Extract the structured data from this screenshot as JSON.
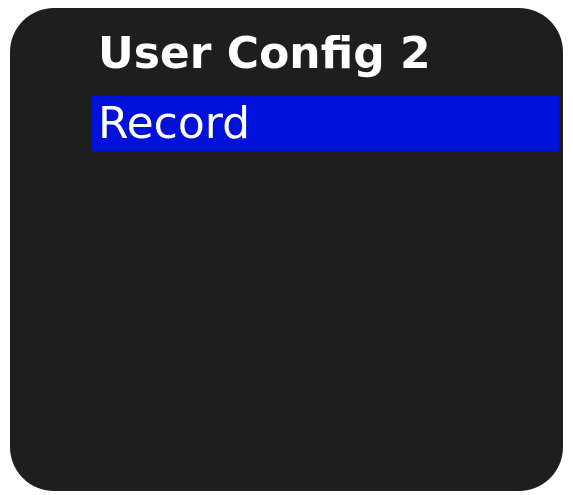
{
  "menu": {
    "title": "User Config 2",
    "items": [
      {
        "label": "Record",
        "selected": true
      }
    ]
  },
  "colors": {
    "screen_background": "#1e1e1e",
    "text": "#ffffff",
    "selection_highlight": "#0012d9"
  }
}
